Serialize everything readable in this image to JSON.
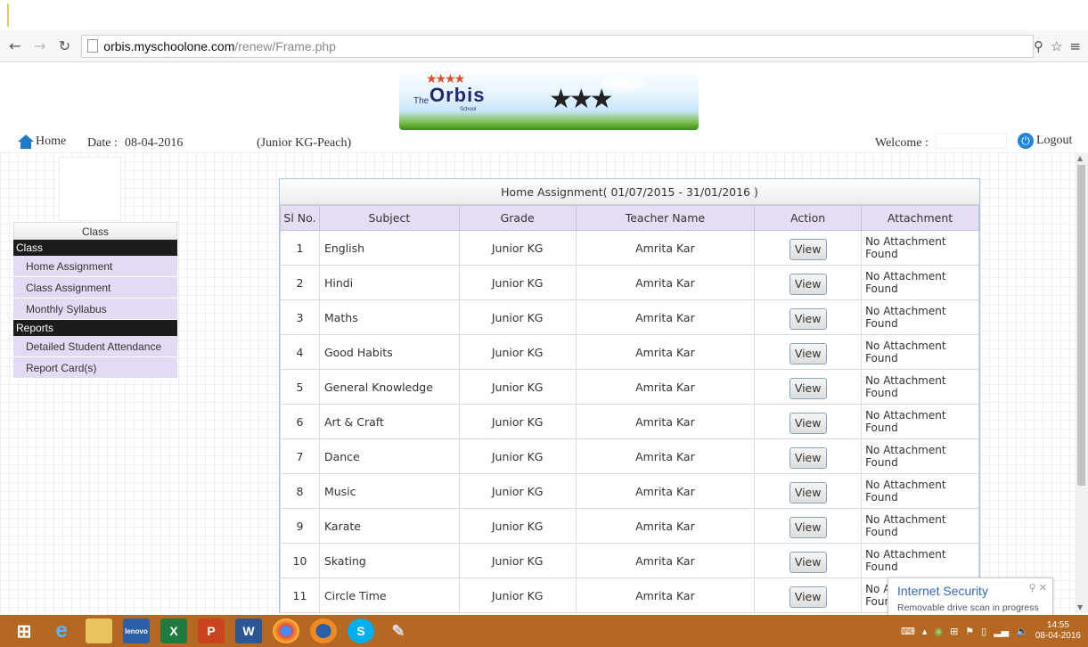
{
  "browser": {
    "url_domain": "orbis.myschoolone.com",
    "url_path": "/renew/Frame.php"
  },
  "banner": {
    "logo_the": "The",
    "logo_name": "Orbis",
    "logo_school": "School"
  },
  "topline": {
    "home": "Home",
    "date_label": "Date :",
    "date_value": "08-04-2016",
    "class_name": "(Junior KG-Peach)",
    "welcome": "Welcome :",
    "logout": "Logout"
  },
  "sidebar": {
    "top_label": "Class",
    "sections": [
      {
        "heading": "Class",
        "items": [
          "Home Assignment",
          "Class Assignment",
          "Monthly Syllabus"
        ]
      },
      {
        "heading": "Reports",
        "items": [
          "Detailed Student Attendance",
          "Report Card(s)"
        ]
      }
    ]
  },
  "table": {
    "title": "Home Assignment( 01/07/2015 - 31/01/2016 )",
    "columns": [
      "Sl No.",
      "Subject",
      "Grade",
      "Teacher Name",
      "Action",
      "Attachment"
    ],
    "rows": [
      {
        "sl": "1",
        "subject": "English",
        "grade": "Junior KG",
        "teacher": "Amrita  Kar",
        "action": "View",
        "attachment": "No Attachment Found"
      },
      {
        "sl": "2",
        "subject": "Hindi",
        "grade": "Junior KG",
        "teacher": "Amrita  Kar",
        "action": "View",
        "attachment": "No Attachment Found"
      },
      {
        "sl": "3",
        "subject": "Maths",
        "grade": "Junior KG",
        "teacher": "Amrita  Kar",
        "action": "View",
        "attachment": "No Attachment Found"
      },
      {
        "sl": "4",
        "subject": "Good Habits",
        "grade": "Junior KG",
        "teacher": "Amrita  Kar",
        "action": "View",
        "attachment": "No Attachment Found"
      },
      {
        "sl": "5",
        "subject": "General Knowledge",
        "grade": "Junior KG",
        "teacher": "Amrita  Kar",
        "action": "View",
        "attachment": "No Attachment Found"
      },
      {
        "sl": "6",
        "subject": "Art & Craft",
        "grade": "Junior KG",
        "teacher": "Amrita  Kar",
        "action": "View",
        "attachment": "No Attachment Found"
      },
      {
        "sl": "7",
        "subject": "Dance",
        "grade": "Junior KG",
        "teacher": "Amrita  Kar",
        "action": "View",
        "attachment": "No Attachment Found"
      },
      {
        "sl": "8",
        "subject": "Music",
        "grade": "Junior KG",
        "teacher": "Amrita  Kar",
        "action": "View",
        "attachment": "No Attachment Found"
      },
      {
        "sl": "9",
        "subject": "Karate",
        "grade": "Junior KG",
        "teacher": "Amrita  Kar",
        "action": "View",
        "attachment": "No Attachment Found"
      },
      {
        "sl": "10",
        "subject": "Skating",
        "grade": "Junior KG",
        "teacher": "Amrita  Kar",
        "action": "View",
        "attachment": "No Attachment Found"
      },
      {
        "sl": "11",
        "subject": "Circle Time",
        "grade": "Junior KG",
        "teacher": "Amrita  Kar",
        "action": "View",
        "attachment": "No Attachment Found"
      }
    ]
  },
  "toast": {
    "title": "Internet Security",
    "message": "Removable drive scan in progress"
  },
  "taskbar": {
    "icons": [
      "windows-start-icon",
      "internet-explorer-icon",
      "file-explorer-icon",
      "lenovo-icon",
      "excel-icon",
      "powerpoint-icon",
      "word-icon",
      "chrome-icon",
      "firefox-icon",
      "skype-icon",
      "paint-icon"
    ],
    "time": "14:55",
    "date": "08-04-2016"
  },
  "colors": {
    "accent_purple": "#e6dcf4",
    "sidebar_heading": "#1c1c1c",
    "taskbar": "#b56822"
  }
}
